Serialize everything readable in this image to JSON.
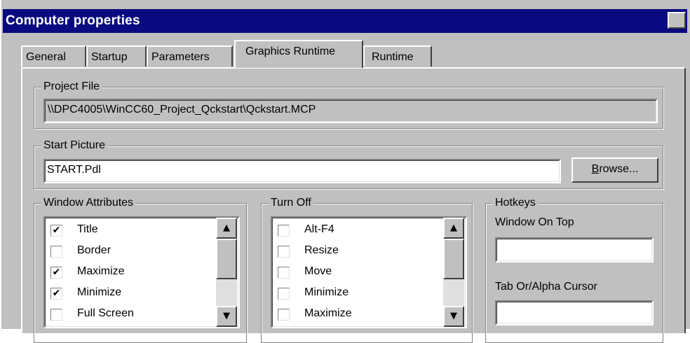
{
  "window": {
    "title": "Computer properties",
    "close_glyph": "✕"
  },
  "tabs": [
    {
      "label": "General"
    },
    {
      "label": "Startup"
    },
    {
      "label": "Parameters"
    },
    {
      "label": "Graphics Runtime",
      "active": true
    },
    {
      "label": "Runtime"
    }
  ],
  "project_file": {
    "legend": "Project File",
    "value": "\\\\DPC4005\\WinCC60_Project_Qckstart\\Qckstart.MCP"
  },
  "start_picture": {
    "legend": "Start Picture",
    "value": "START.Pdl",
    "browse_label_underlined": "B",
    "browse_label_rest": "rowse..."
  },
  "window_attributes": {
    "legend": "Window Attributes",
    "items": [
      {
        "label": "Title",
        "checked": true
      },
      {
        "label": "Border",
        "checked": false
      },
      {
        "label": "Maximize",
        "checked": true
      },
      {
        "label": "Minimize",
        "checked": true
      },
      {
        "label": "Full Screen",
        "checked": false
      }
    ]
  },
  "turn_off": {
    "legend": "Turn Off",
    "items": [
      {
        "label": "Alt-F4",
        "checked": false
      },
      {
        "label": "Resize",
        "checked": false
      },
      {
        "label": "Move",
        "checked": false
      },
      {
        "label": "Minimize",
        "checked": false
      },
      {
        "label": "Maximize",
        "checked": false
      }
    ]
  },
  "hotkeys": {
    "legend": "Hotkeys",
    "window_on_top_label": "Window On Top",
    "window_on_top_value": "",
    "tab_cursor_label": "Tab Or/Alpha Cursor",
    "tab_cursor_value": ""
  },
  "glyphs": {
    "check": "✔",
    "up_arrow": "▲",
    "down_arrow": "▼"
  },
  "colors": {
    "title_bar": "#0a0a80",
    "face": "#c0c0c0"
  }
}
